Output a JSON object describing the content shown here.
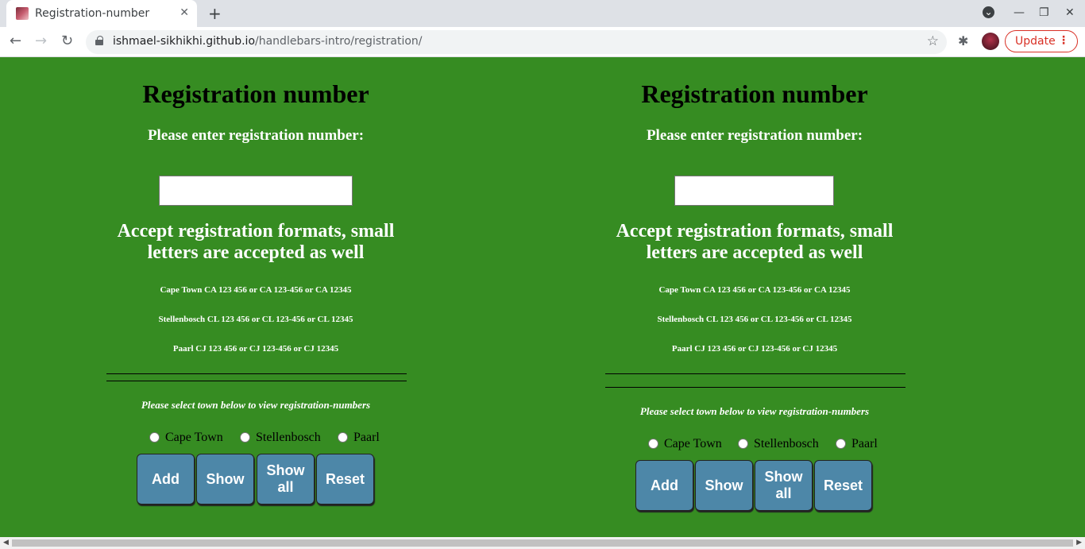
{
  "browser": {
    "tab_title": "Registration-number",
    "tab_close": "✕",
    "new_tab": "+",
    "url_host": "ishmael-sikhikhi.github.io",
    "url_path": "/handlebars-intro/registration/",
    "update_label": "Update",
    "update_menu": "⋮",
    "back": "←",
    "forward": "→",
    "reload": "↻",
    "star": "☆",
    "extensions": "✱",
    "tab_search": "⌄",
    "minimize": "—",
    "restore": "❐",
    "close": "✕"
  },
  "panels": [
    {
      "title": "Registration number",
      "prompt": "Please enter registration number:",
      "input_value": "",
      "formats_heading_1": "Accept registration formats, small",
      "formats_heading_2": "letters are accepted as well",
      "examples": [
        "Cape Town CA 123 456 or CA 123-456 or CA 12345",
        "Stellenbosch CL 123 456 or CL 123-456 or CL 12345",
        "Paarl CJ 123 456 or CJ 123-456 or CJ 12345"
      ],
      "select_prompt": "Please select town below to view registration-numbers",
      "towns": [
        "Cape Town",
        "Stellenbosch",
        "Paarl"
      ],
      "buttons": {
        "add": "Add",
        "show": "Show",
        "show_all_1": "Show",
        "show_all_2": "all",
        "reset": "Reset"
      }
    },
    {
      "title": "Registration number",
      "prompt": "Please enter registration number:",
      "input_value": "",
      "formats_heading_1": "Accept registration formats, small",
      "formats_heading_2": "letters are accepted as well",
      "examples": [
        "Cape Town CA 123 456 or CA 123-456 or CA 12345",
        "Stellenbosch CL 123 456 or CL 123-456 or CL 12345",
        "Paarl CJ 123 456 or CJ 123-456 or CJ 12345"
      ],
      "select_prompt": "Please select town below to view registration-numbers",
      "towns": [
        "Cape Town",
        "Stellenbosch",
        "Paarl"
      ],
      "buttons": {
        "add": "Add",
        "show": "Show",
        "show_all_1": "Show",
        "show_all_2": "all",
        "reset": "Reset"
      }
    }
  ],
  "colors": {
    "page_background": "#368c22",
    "button_background": "#4d87a8",
    "update_accent": "#d93025"
  }
}
